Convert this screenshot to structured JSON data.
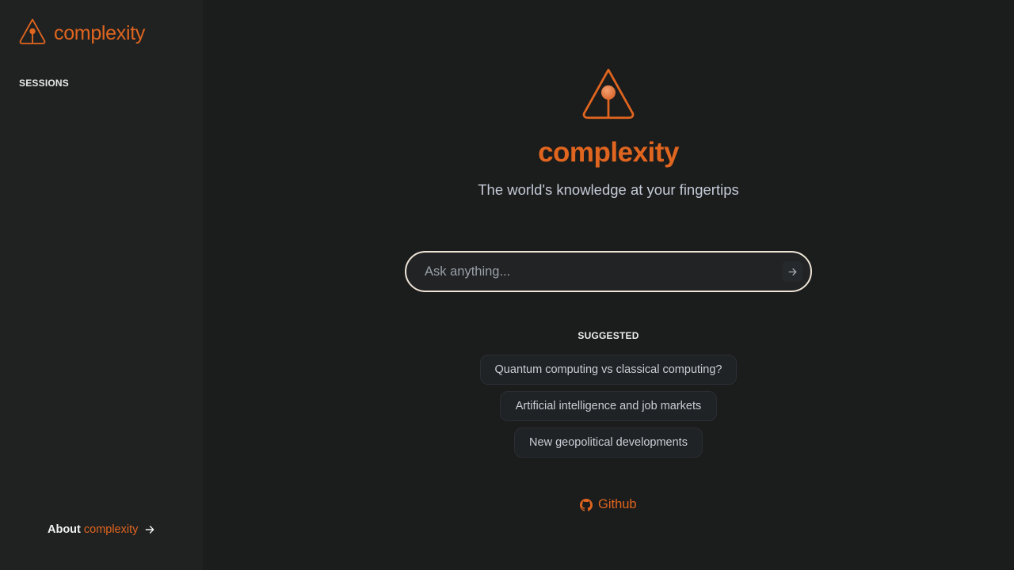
{
  "app": {
    "brand_name": "complexity",
    "logo_icon": "complexity-logo-icon"
  },
  "sidebar": {
    "sessions_heading": "SESSIONS",
    "about_prefix": "About",
    "about_accent": "complexity",
    "about_icon": "arrow-right-icon"
  },
  "hero": {
    "title": "complexity",
    "subtitle": "The world's knowledge at your fingertips"
  },
  "search": {
    "value": "",
    "placeholder": "Ask anything...",
    "submit_icon": "arrow-right-icon"
  },
  "suggested": {
    "heading": "SUGGESTED",
    "items": [
      {
        "label": "Quantum computing vs classical computing?"
      },
      {
        "label": "Artificial intelligence and job markets"
      },
      {
        "label": "New geopolitical developments"
      }
    ]
  },
  "footer": {
    "github_label": "Github",
    "github_icon": "github-icon"
  },
  "colors": {
    "accent": "#e0651f",
    "background": "#1b1c1c",
    "sidebar": "#202121",
    "search_border": "#ede4d6"
  }
}
